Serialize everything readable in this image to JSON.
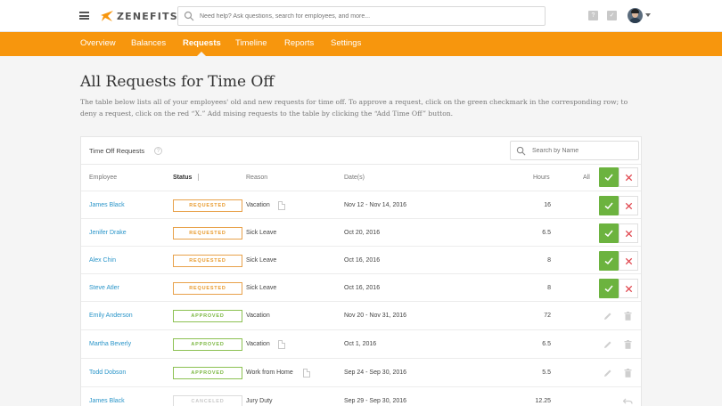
{
  "app": {
    "logo_text": "ZENEFITS",
    "search_placeholder": "Need help? Ask questions, search for employees, and more..."
  },
  "nav": {
    "tabs": [
      "Overview",
      "Balances",
      "Requests",
      "Timeline",
      "Reports",
      "Settings"
    ],
    "active": "Requests"
  },
  "page": {
    "title": "All Requests for Time Off",
    "intro": "The table below lists all of your employees' old and new requests for time off. To approve a request, click on the green checkmark in the corresponding row; to deny a request, click on the red “X.” Add mising requests to the table by clicking the “Add Time Off” button."
  },
  "table": {
    "title": "Time Off Requests",
    "help": "?",
    "search_placeholder": "Search by Name",
    "columns": {
      "employee": "Employee",
      "status": "Status",
      "reason": "Reason",
      "dates": "Date(s)",
      "hours": "Hours",
      "all": "All"
    },
    "rows": [
      {
        "employee": "James Black",
        "status": "REQUESTED",
        "reason": "Vacation",
        "note": true,
        "dates": "Nov 12 - Nov 14, 2016",
        "hours": "16",
        "actions": "approve"
      },
      {
        "employee": "Jenifer Drake",
        "status": "REQUESTED",
        "reason": "Sick Leave",
        "note": false,
        "dates": "Oct 20, 2016",
        "hours": "6.5",
        "actions": "approve"
      },
      {
        "employee": "Alex Chin",
        "status": "REQUESTED",
        "reason": "Sick Leave",
        "note": false,
        "dates": "Oct 16, 2016",
        "hours": "8",
        "actions": "approve"
      },
      {
        "employee": "Steve Atler",
        "status": "REQUESTED",
        "reason": "Sick Leave",
        "note": false,
        "dates": "Oct 16, 2016",
        "hours": "8",
        "actions": "approve"
      },
      {
        "employee": "Emily Anderson",
        "status": "APPROVED",
        "reason": "Vacation",
        "note": false,
        "dates": "Nov 20 - Nov 31, 2016",
        "hours": "72",
        "actions": "edit"
      },
      {
        "employee": "Martha Beverly",
        "status": "APPROVED",
        "reason": "Vacation",
        "note": true,
        "dates": "Oct 1, 2016",
        "hours": "6.5",
        "actions": "edit"
      },
      {
        "employee": "Todd Dobson",
        "status": "APPROVED",
        "reason": "Work from Home",
        "note": true,
        "dates": "Sep 24 - Sep 30, 2016",
        "hours": "5.5",
        "actions": "edit"
      },
      {
        "employee": "James Black",
        "status": "CANCELED",
        "reason": "Jury Duty",
        "note": false,
        "dates": "Sep 29 - Sep 30, 2016",
        "hours": "12.25",
        "actions": "undo"
      }
    ]
  },
  "colors": {
    "brand_orange": "#f7960d",
    "approve_green": "#6cb33f",
    "deny_red": "#e0434b",
    "link_blue": "#2a95c9"
  }
}
